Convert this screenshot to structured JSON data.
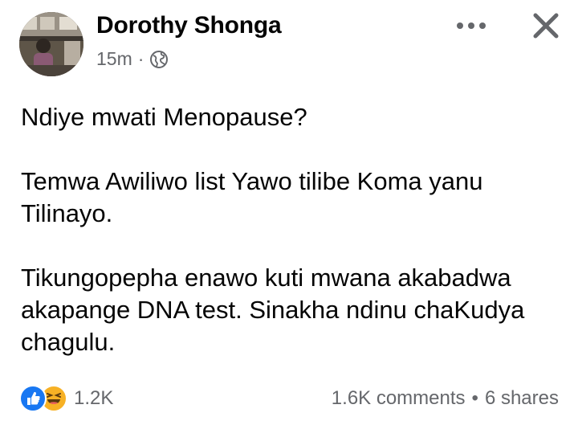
{
  "post": {
    "author": "Dorothy Shonga",
    "timestamp": "15m",
    "meta_separator": "·",
    "privacy_icon": "globe-icon",
    "more_icon": "more-horizontal-icon",
    "close_icon": "close-icon",
    "paragraphs": [
      "Ndiye mwati Menopause?",
      "Temwa Awiliwo list Yawo tilibe Koma yanu Tilinayo.",
      "Tikungopepha enawo kuti mwana akabadwa akapange DNA test. Sinakha ndinu chaKudya chagulu."
    ]
  },
  "footer": {
    "reaction_icons": [
      "like-icon",
      "haha-icon"
    ],
    "reaction_count": "1.2K",
    "comments": "1.6K comments",
    "separator": "•",
    "shares": "6 shares"
  },
  "colors": {
    "text": "#050505",
    "secondary": "#65676b",
    "like_blue": "#1877f2",
    "haha_yellow": "#f7b125"
  }
}
